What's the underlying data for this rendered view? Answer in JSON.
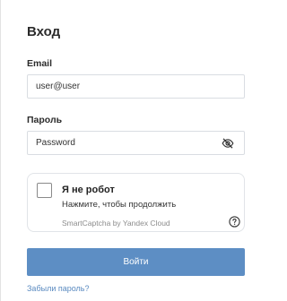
{
  "form": {
    "title": "Вход",
    "email_label": "Email",
    "email_value": "user@user",
    "password_label": "Пароль",
    "password_placeholder": "Password",
    "password_toggle_icon": "eye-slash-icon",
    "submit_label": "Войти",
    "forgot_link": "Забыли пароль?"
  },
  "captcha": {
    "title": "Я не робот",
    "subtitle": "Нажмите, чтобы продолжить",
    "brand": "SmartCaptcha by Yandex Cloud",
    "checked": false,
    "help_icon": "question-circle-icon"
  },
  "colors": {
    "accent": "#5d8ec4",
    "link": "#5a8ac0",
    "border": "#d9dde2"
  }
}
